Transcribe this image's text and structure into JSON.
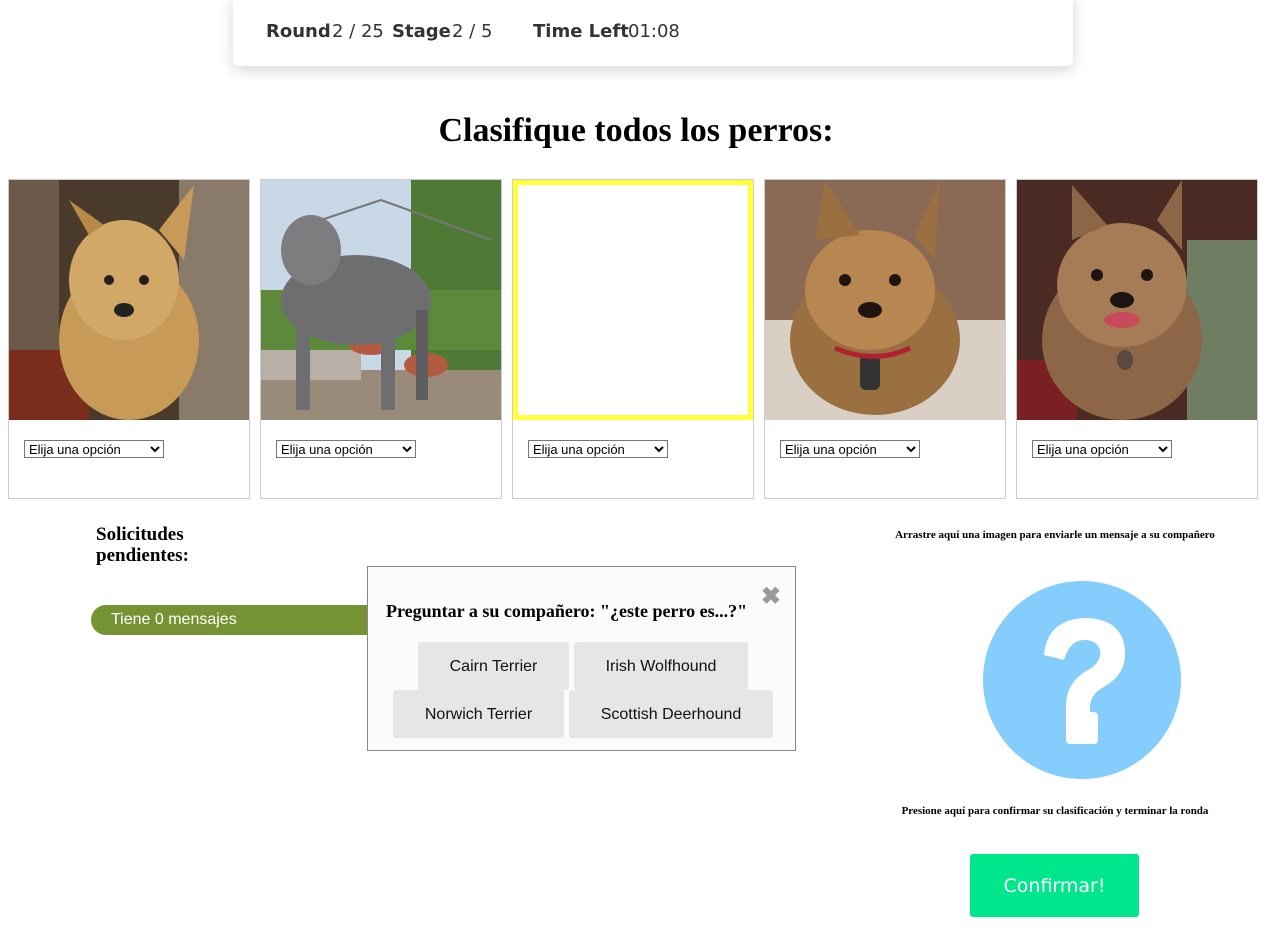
{
  "status": {
    "round_label": "Round",
    "round_value": "2 / 25",
    "stage_label": "Stage",
    "stage_value": "2 / 5",
    "time_label": "Time Left",
    "time_value": "01:08"
  },
  "heading": "Clasifique todos los perros:",
  "dogs": [
    {
      "select_value": "Elija una opción",
      "selected": false
    },
    {
      "select_value": "Elija una opción",
      "selected": false
    },
    {
      "select_value": "Elija una opción",
      "selected": true
    },
    {
      "select_value": "Elija una opción",
      "selected": false
    },
    {
      "select_value": "Elija una opción",
      "selected": false
    }
  ],
  "pending": {
    "title": "Solicitudes pendientes:",
    "messages": "Tiene 0 mensajes"
  },
  "popup": {
    "question": "Preguntar a su compañero: \"¿este perro es...?\"",
    "close": "✖",
    "options": [
      "Cairn Terrier",
      "Irish Wolfhound",
      "Norwich Terrier",
      "Scottish Deerhound"
    ]
  },
  "right": {
    "drag_help": "Arrastre aquí una imagen para enviarle un mensaje a su compañero",
    "confirm_help": "Presione aquí para confirmar su clasificación y terminar la ronda",
    "confirm_button": "Confirmar!"
  },
  "colors": {
    "accent_green": "#00e68c",
    "message_bar": "#769333",
    "selected_border": "#ffff3a",
    "question_icon": "#85cdfd"
  }
}
